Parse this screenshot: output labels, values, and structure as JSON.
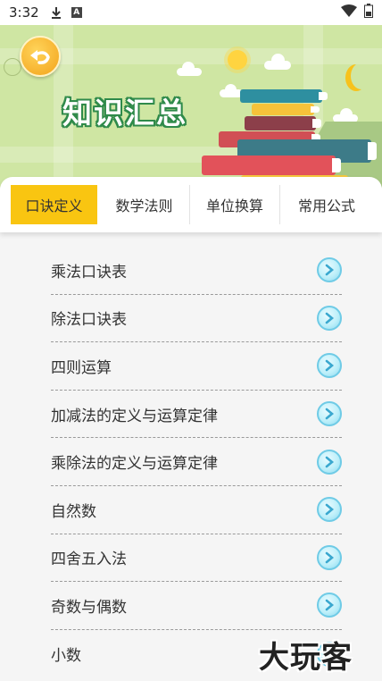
{
  "status_bar": {
    "time": "3:32",
    "download_icon": "download-icon",
    "badge": "A",
    "wifi_icon": "wifi-icon",
    "battery_icon": "battery-icon"
  },
  "header": {
    "title": "知识汇总",
    "back_icon": "back-arrow-icon"
  },
  "tabs": [
    {
      "label": "口诀定义",
      "active": true
    },
    {
      "label": "数学法则",
      "active": false
    },
    {
      "label": "单位换算",
      "active": false
    },
    {
      "label": "常用公式",
      "active": false
    }
  ],
  "items": [
    {
      "label": "乘法口诀表"
    },
    {
      "label": "除法口诀表"
    },
    {
      "label": "四则运算"
    },
    {
      "label": "加减法的定义与运算定律"
    },
    {
      "label": "乘除法的定义与运算定律"
    },
    {
      "label": "自然数"
    },
    {
      "label": "四舍五入法"
    },
    {
      "label": "奇数与偶数"
    },
    {
      "label": "小数"
    }
  ],
  "watermark": "大玩客",
  "colors": {
    "banner": "#cfe6a3",
    "active_tab": "#f9c511",
    "title_outline": "#2f8a4a",
    "chevron": "#6fcbe6"
  }
}
